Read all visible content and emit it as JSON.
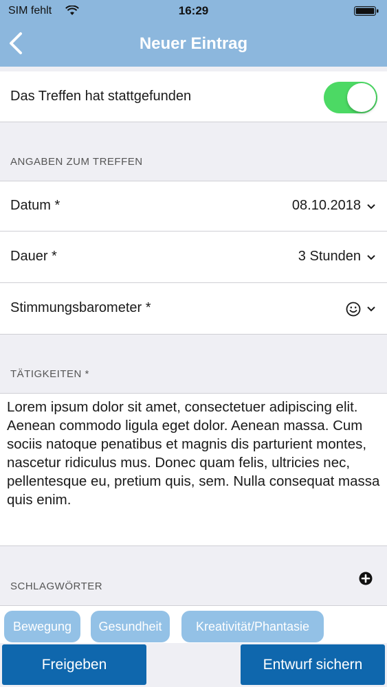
{
  "status_bar": {
    "carrier": "SIM fehlt",
    "time": "16:29"
  },
  "header": {
    "title": "Neuer Eintrag"
  },
  "toggle_row": {
    "label": "Das Treffen hat stattgefunden",
    "state": "on"
  },
  "section_meeting": {
    "label": "ANGABEN ZUM TREFFEN"
  },
  "date_row": {
    "label": "Datum *",
    "value": "08.10.2018"
  },
  "duration_row": {
    "label": "Dauer *",
    "value": "3 Stunden"
  },
  "mood_row": {
    "label": "Stimmungsbarometer *",
    "icon": "smiley-icon"
  },
  "section_activities": {
    "label": "TÄTIGKEITEN *"
  },
  "activities_text": "Lorem ipsum dolor sit amet, consectetuer adipiscing elit. Aenean commodo ligula eget dolor. Aenean massa. Cum sociis natoque penatibus et magnis dis parturient montes, nascetur ridiculus mus. Donec quam felis, ultricies nec, pellentesque eu, pretium quis, sem. Nulla consequat massa quis enim.",
  "section_keywords": {
    "label": "SCHLAGWÖRTER"
  },
  "tags": [
    "Bewegung",
    "Gesundheit",
    "Kreativität/Phantasie"
  ],
  "buttons": {
    "release": "Freigeben",
    "save_draft": "Entwurf sichern"
  },
  "colors": {
    "header": "#8cb7dd",
    "toggle_on": "#4cd964",
    "tag": "#93c1e6",
    "button": "#0f67ad"
  }
}
